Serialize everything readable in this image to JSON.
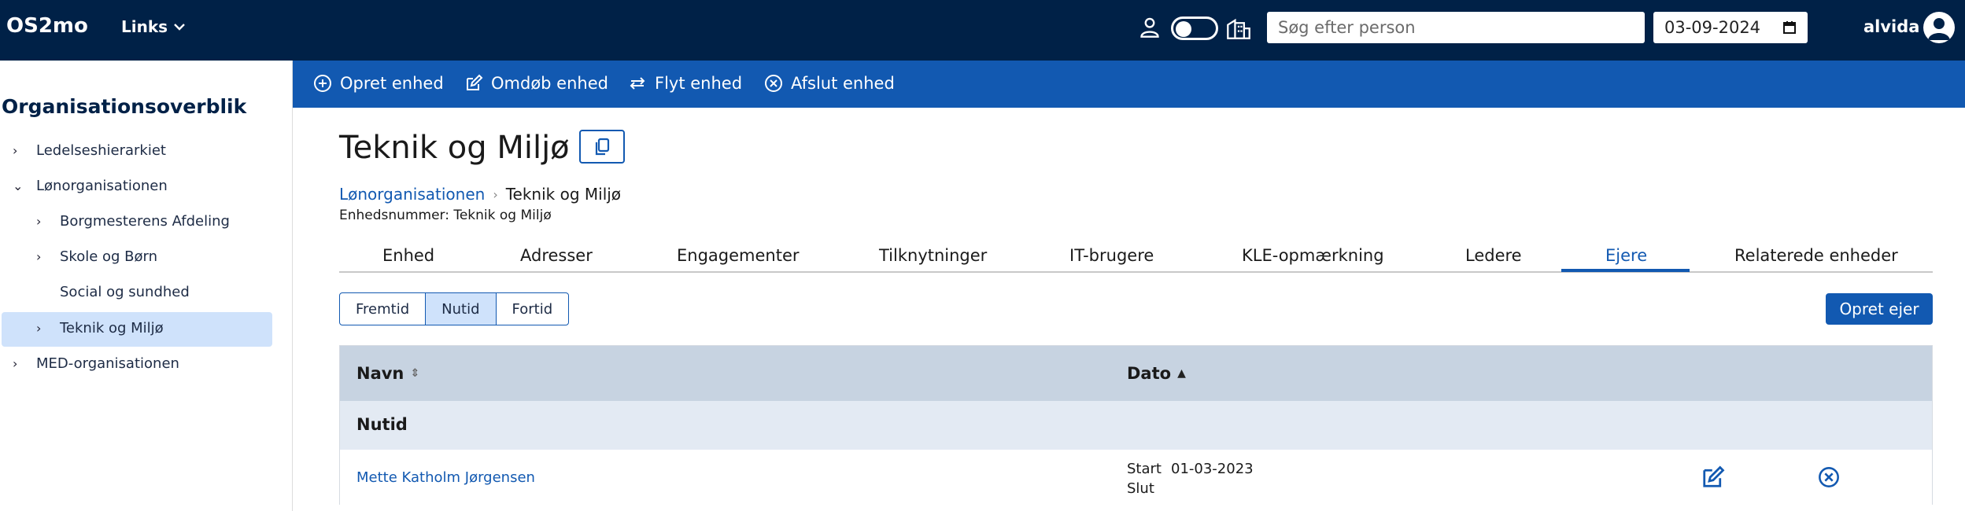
{
  "topbar": {
    "brand": "OS2mo",
    "links_label": "Links",
    "search_placeholder": "Søg efter person",
    "date_value": "03-09-2024",
    "username": "alvida"
  },
  "sidebar": {
    "title": "Organisationsoverblik",
    "items": [
      {
        "label": "Ledelseshierarkiet",
        "chevron": "›"
      },
      {
        "label": "Lønorganisationen",
        "chevron": "⌄"
      },
      {
        "label": "Borgmesterens Afdeling",
        "chevron": "›"
      },
      {
        "label": "Skole og Børn",
        "chevron": "›"
      },
      {
        "label": "Social og sundhed",
        "chevron": ""
      },
      {
        "label": "Teknik og Miljø",
        "chevron": "›"
      },
      {
        "label": "MED-organisationen",
        "chevron": "›"
      }
    ]
  },
  "actions": {
    "create": "Opret enhed",
    "rename": "Omdøb enhed",
    "move": "Flyt enhed",
    "terminate": "Afslut enhed"
  },
  "main": {
    "title": "Teknik og Miljø",
    "breadcrumb": [
      "Lønorganisationen",
      "Teknik og Miljø"
    ],
    "unit_number": "Enhedsnummer: Teknik og Miljø",
    "tabs": [
      "Enhed",
      "Adresser",
      "Engagementer",
      "Tilknytninger",
      "IT-brugere",
      "KLE-opmærkning",
      "Ledere",
      "Ejere",
      "Relaterede enheder"
    ],
    "active_tab": "Ejere",
    "time_filter": [
      "Fremtid",
      "Nutid",
      "Fortid"
    ],
    "time_filter_selected": "Nutid",
    "create_owner": "Opret ejer"
  },
  "table": {
    "columns": [
      "Navn",
      "Dato"
    ],
    "group": "Nutid",
    "rows": [
      {
        "name": "Mette Katholm Jørgensen",
        "start_label": "Start",
        "start": "01-03-2023",
        "end_label": "Slut",
        "end": ""
      }
    ]
  },
  "colors": {
    "topbar": "#002147",
    "actionbar": "#1259b1",
    "accent": "#1259b1",
    "selected": "#cfe2fb"
  }
}
